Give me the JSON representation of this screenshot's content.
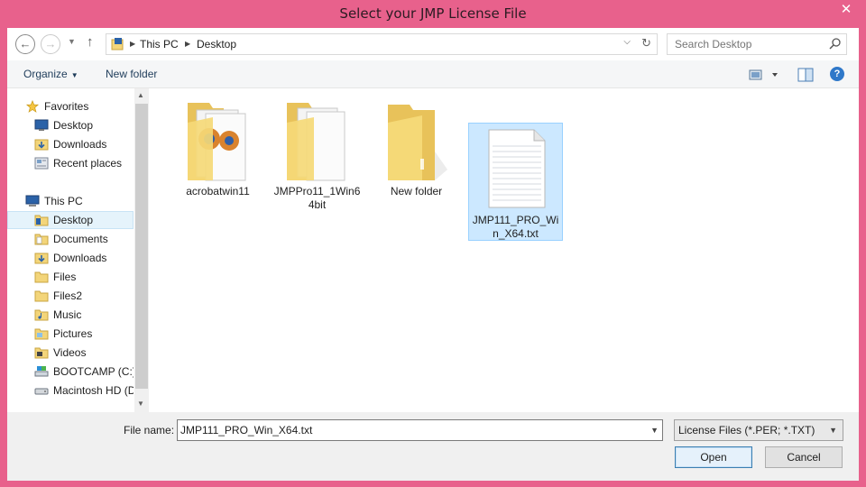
{
  "window": {
    "title": "Select your JMP License File",
    "close_glyph": "✕"
  },
  "nav": {
    "back_glyph": "←",
    "forward_glyph": "→",
    "up_glyph": "↑"
  },
  "address": {
    "crumbs": [
      "This PC",
      "Desktop"
    ]
  },
  "search": {
    "placeholder": "Search Desktop"
  },
  "toolbar": {
    "organize_label": "Organize",
    "new_folder_label": "New folder",
    "help_glyph": "?"
  },
  "sidebar": {
    "items": [
      {
        "label": "Favorites",
        "icon": "star-icon"
      },
      {
        "label": "Desktop",
        "icon": "desktop-icon"
      },
      {
        "label": "Downloads",
        "icon": "downloads-folder-icon"
      },
      {
        "label": "Recent places",
        "icon": "recent-places-icon"
      },
      {
        "label": "This PC",
        "icon": "computer-icon"
      },
      {
        "label": "Desktop",
        "icon": "folder-icon"
      },
      {
        "label": "Documents",
        "icon": "folder-icon"
      },
      {
        "label": "Downloads",
        "icon": "downloads-folder-icon"
      },
      {
        "label": "Files",
        "icon": "folder-icon"
      },
      {
        "label": "Files2",
        "icon": "folder-icon"
      },
      {
        "label": "Music",
        "icon": "folder-icon"
      },
      {
        "label": "Pictures",
        "icon": "folder-icon"
      },
      {
        "label": "Videos",
        "icon": "folder-icon"
      },
      {
        "label": "BOOTCAMP (C:)",
        "icon": "drive-icon"
      },
      {
        "label": "Macintosh HD (D",
        "icon": "drive-icon"
      }
    ],
    "selected": "Desktop"
  },
  "files": [
    {
      "name": "acrobatwin11",
      "type": "folder"
    },
    {
      "name": "JMPPro11_1Win64bit",
      "type": "folder"
    },
    {
      "name": "New folder",
      "type": "folder"
    },
    {
      "name": "JMP111_PRO_Win_X64.txt",
      "type": "text-file",
      "selected": true
    }
  ],
  "bottom": {
    "file_name_label": "File name:",
    "file_name_value": "JMP111_PRO_Win_X64.txt",
    "file_type": "License Files (*.PER; *.TXT)",
    "open_label": "Open",
    "cancel_label": "Cancel"
  },
  "colors": {
    "frame": "#e8618c",
    "selection": "#cce8ff",
    "folder": "#f3d57a"
  }
}
